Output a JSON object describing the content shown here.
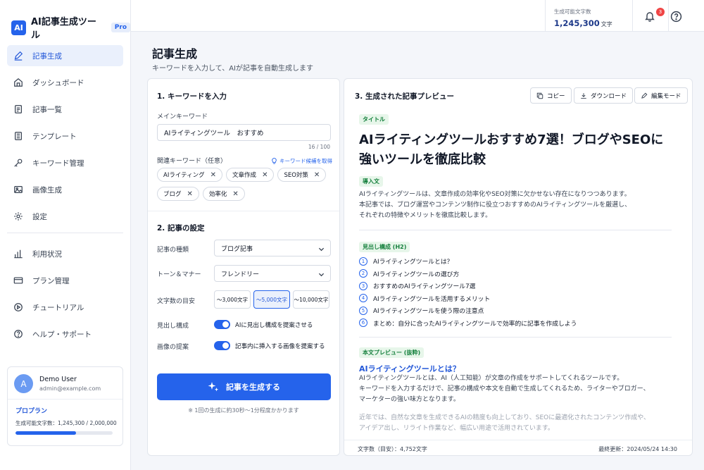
{
  "app": {
    "logo": "AI",
    "name": "AI記事生成ツール",
    "badge": "Pro"
  },
  "sidebar": {
    "items": [
      {
        "label": "記事生成",
        "icon": "pencil-icon"
      },
      {
        "label": "ダッシュボード",
        "icon": "home-icon"
      },
      {
        "label": "記事一覧",
        "icon": "document-list-icon"
      },
      {
        "label": "テンプレート",
        "icon": "template-icon"
      },
      {
        "label": "キーワード管理",
        "icon": "key-icon"
      },
      {
        "label": "画像生成",
        "icon": "image-icon"
      },
      {
        "label": "設定",
        "icon": "gear-icon"
      }
    ],
    "items2": [
      {
        "label": "利用状況",
        "icon": "bar-chart-icon"
      },
      {
        "label": "プラン管理",
        "icon": "card-icon"
      },
      {
        "label": "チュートリアル",
        "icon": "tutorial-icon"
      },
      {
        "label": "ヘルプ・サポート",
        "icon": "help-icon"
      }
    ]
  },
  "user": {
    "initial": "A",
    "name": "Demo User",
    "email": "admin@example.com",
    "plan": "プロプラン",
    "usage": "生成可能文字数：1,245,300 / 2,000,000",
    "usage_fraction": 0.623
  },
  "header": {
    "credits_label": "生成可能文字数",
    "credits_value": "1,245,300",
    "credits_unit": "文字",
    "notifications": "3"
  },
  "page": {
    "title": "記事生成",
    "subtitle": "キーワードを入力して、AIが記事を自動生成します"
  },
  "form": {
    "section1": "1. キーワードを入力",
    "main_kw_label": "メインキーワード",
    "main_kw_value": "AIライティングツール　おすすめ",
    "main_kw_count": "16 / 100",
    "related_label": "関連キーワード（任意）",
    "suggest_link": "キーワード候補を取得",
    "chips": [
      "AIライティング",
      "文章作成",
      "SEO対策",
      "ブログ",
      "効率化"
    ],
    "section2": "2. 記事の設定",
    "type_label": "記事の種類",
    "type_value": "ブログ記事",
    "tone_label": "トーン＆マナー",
    "tone_value": "フレンドリー",
    "length_label": "文字数の目安",
    "length_options": [
      "〜3,000文字",
      "〜5,000文字",
      "〜10,000文字"
    ],
    "heading_label": "見出し構成",
    "heading_toggle_text": "AIに見出し構成を提案させる",
    "image_label": "画像の提案",
    "image_toggle_text": "記事内に挿入する画像を提案する",
    "generate_button": "記事を生成する",
    "generate_note": "※ 1回の生成に約30秒〜1分程度かかります"
  },
  "preview": {
    "section3": "3. 生成された記事プレビュー",
    "copy_button": "コピー",
    "download_button": "ダウンロード",
    "edit_button": "編集モード",
    "title_tag": "タイトル",
    "title_line1": "AIライティングツールおすすめ7選！ブログやSEOに",
    "title_line2": "強いツールを徹底比較",
    "intro_tag": "導入文",
    "intro_lines": [
      "AIライティングツールは、文章作成の効率化やSEO対策に欠かせない存在になりつつあります。",
      "本記事では、ブログ運営やコンテンツ制作に役立つおすすめのAIライティングツールを厳選し、",
      "それぞれの特徴やメリットを徹底比較します。"
    ],
    "outline_tag": "見出し構成 (H2)",
    "outline": [
      {
        "num": "1",
        "text": "AIライティングツールとは？"
      },
      {
        "num": "2",
        "text": "AIライティングツールの選び方"
      },
      {
        "num": "3",
        "text": "おすすめのAIライティングツール7選"
      },
      {
        "num": "4",
        "text": "AIライティングツールを活用するメリット"
      },
      {
        "num": "5",
        "text": "AIライティングツールを使う際の注意点"
      },
      {
        "num": "6",
        "text": "まとめ：自分に合ったAIライティングツールで効率的に記事を作成しよう"
      }
    ],
    "body_tag": "本文プレビュー (抜粋)",
    "body_heading": "AIライティングツールとは？",
    "body_lines": [
      "AIライティングツールとは、AI（人工知能）が文章の作成をサポートしてくれるツールです。",
      "キーワードを入力するだけで、記事の構成や本文を自動で生成してくれるため、ライターやブロガー、",
      "マーケターの強い味方となります。"
    ],
    "body_fade_lines": [
      "近年では、自然な文章を生成できるAIの精度も向上しており、SEOに最適化されたコンテンツ作成や、",
      "アイデア出し、リライト作業など、幅広い用途で活用されています。"
    ],
    "footer_count": "文字数（目安）：4,752文字",
    "footer_updated": "最終更新：2024/05/24 14:30"
  },
  "colors": {
    "accent": "#2563eb",
    "tag_green": "#15803d",
    "badge_red": "#ef4444"
  }
}
